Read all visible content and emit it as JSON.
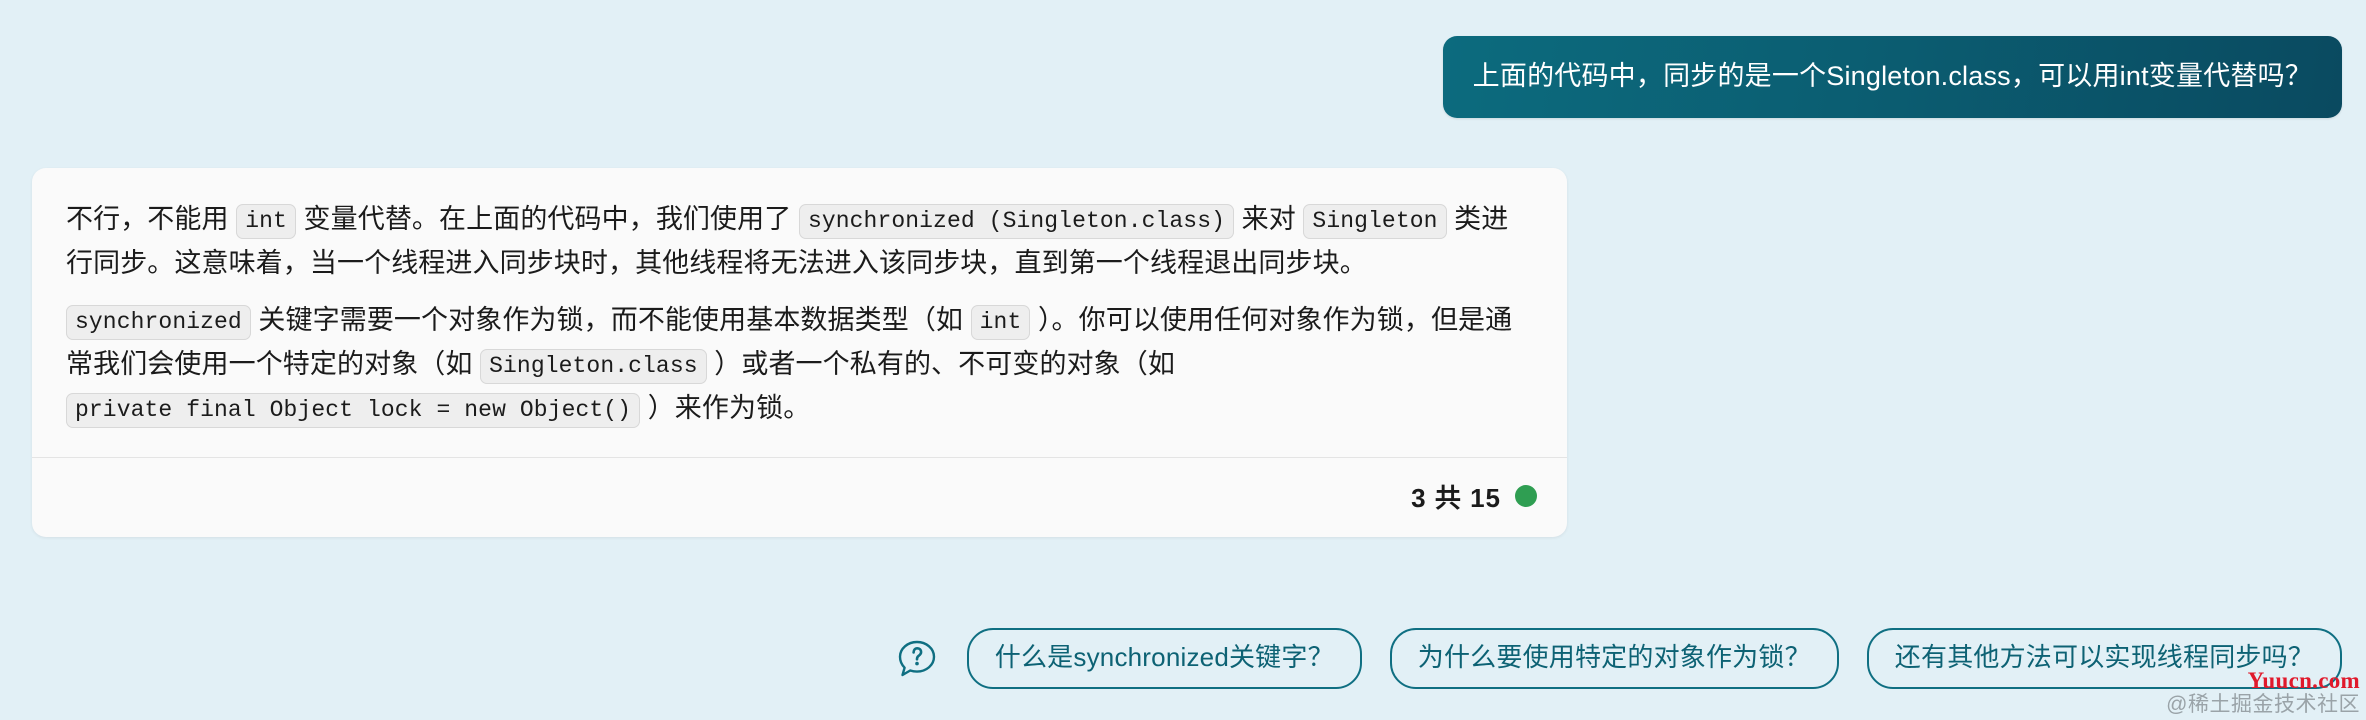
{
  "conversation": {
    "user_message": "上面的代码中，同步的是一个Singleton.class，可以用int变量代替吗？",
    "answer": {
      "paragraph1": [
        {
          "type": "text",
          "value": "不行，不能用 "
        },
        {
          "type": "code",
          "value": "int"
        },
        {
          "type": "text",
          "value": " 变量代替。在上面的代码中，我们使用了 "
        },
        {
          "type": "code",
          "value": "synchronized (Singleton.class)"
        },
        {
          "type": "text",
          "value": " 来对 "
        },
        {
          "type": "code",
          "value": "Singleton"
        },
        {
          "type": "text",
          "value": " 类进行同步。这意味着，当一个线程进入同步块时，其他线程将无法进入该同步块，直到第一个线程退出同步块。"
        }
      ],
      "paragraph2": [
        {
          "type": "code",
          "value": "synchronized"
        },
        {
          "type": "text",
          "value": " 关键字需要一个对象作为锁，而不能使用基本数据类型（如 "
        },
        {
          "type": "code",
          "value": "int"
        },
        {
          "type": "text",
          "value": " ）。你可以使用任何对象作为锁，但是通常我们会使用一个特定的对象（如 "
        },
        {
          "type": "code",
          "value": "Singleton.class"
        },
        {
          "type": "text",
          "value": " ）或者一个私有的、不可变的对象（如 "
        },
        {
          "type": "code",
          "value": "private final Object lock = new Object()"
        },
        {
          "type": "text",
          "value": " ）来作为锁。"
        }
      ],
      "footer": {
        "counter": "3 共 15",
        "status_color": "#2f9e52"
      }
    }
  },
  "suggestions": {
    "help_icon": "question-speech-bubble-icon",
    "items": [
      {
        "label": "什么是synchronized关键字？"
      },
      {
        "label": "为什么要使用特定的对象作为锁？"
      },
      {
        "label": "还有其他方法可以实现线程同步吗？"
      }
    ]
  },
  "watermark": {
    "primary": "Yuucn.com",
    "secondary": "@稀土掘金技术社区"
  },
  "colors": {
    "page_background": "#e2f0f6",
    "bubble_start": "#0c6b7e",
    "bubble_end": "#0a4a60",
    "card_background": "#fafafa",
    "accent": "#0f6f82",
    "status_green": "#2f9e52",
    "watermark_red": "#e0192b"
  }
}
